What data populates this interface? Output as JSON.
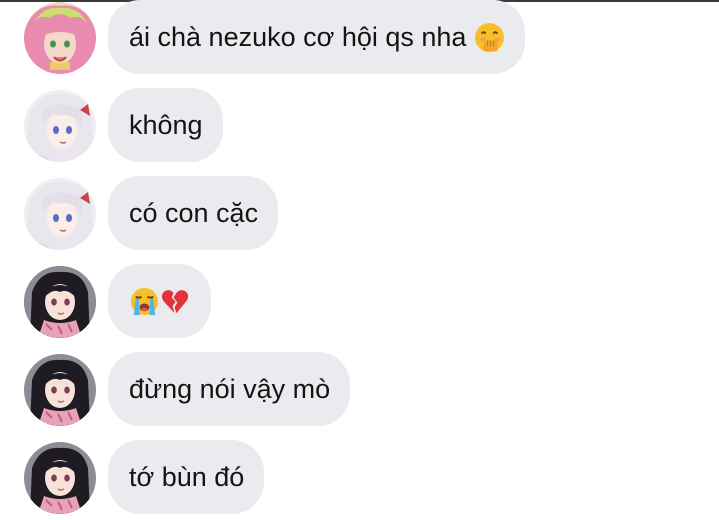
{
  "messages": [
    {
      "sender": "pink-hair",
      "text": "ái chà nezuko cơ hội qs nha",
      "emoji": [
        "hand-over-mouth-emoji"
      ]
    },
    {
      "sender": "white-hair",
      "text": "không",
      "emoji": []
    },
    {
      "sender": "white-hair",
      "text": "có con cặc",
      "emoji": []
    },
    {
      "sender": "dark-hair",
      "text": "",
      "emoji": [
        "loudly-crying-emoji",
        "broken-heart-emoji"
      ]
    },
    {
      "sender": "dark-hair",
      "text": "đừng nói vậy mò",
      "emoji": []
    },
    {
      "sender": "dark-hair",
      "text": "tớ bùn đó",
      "emoji": []
    }
  ],
  "colors": {
    "bubble": "#e9ebee",
    "text": "#141414",
    "background": "#ffffff"
  }
}
